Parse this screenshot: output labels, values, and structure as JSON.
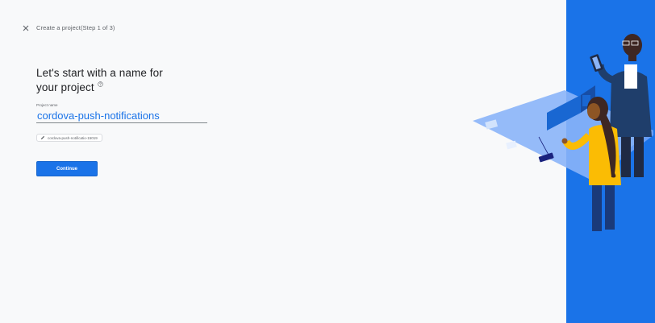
{
  "header": {
    "title": "Create a project(Step 1 of 3)"
  },
  "main": {
    "heading_line1": "Let's start with a name for",
    "heading_line2": "your project",
    "field_label": "Project name",
    "field_value": "cordova-push-notifications",
    "project_id": "cordova-push-notificatio-15019",
    "continue_label": "Continue"
  },
  "icons": {
    "close": "close-icon",
    "help": "help-icon",
    "edit": "pencil-icon"
  },
  "colors": {
    "accent": "#1a73e8",
    "panel": "#1a73e8",
    "background": "#f8f9fa"
  }
}
